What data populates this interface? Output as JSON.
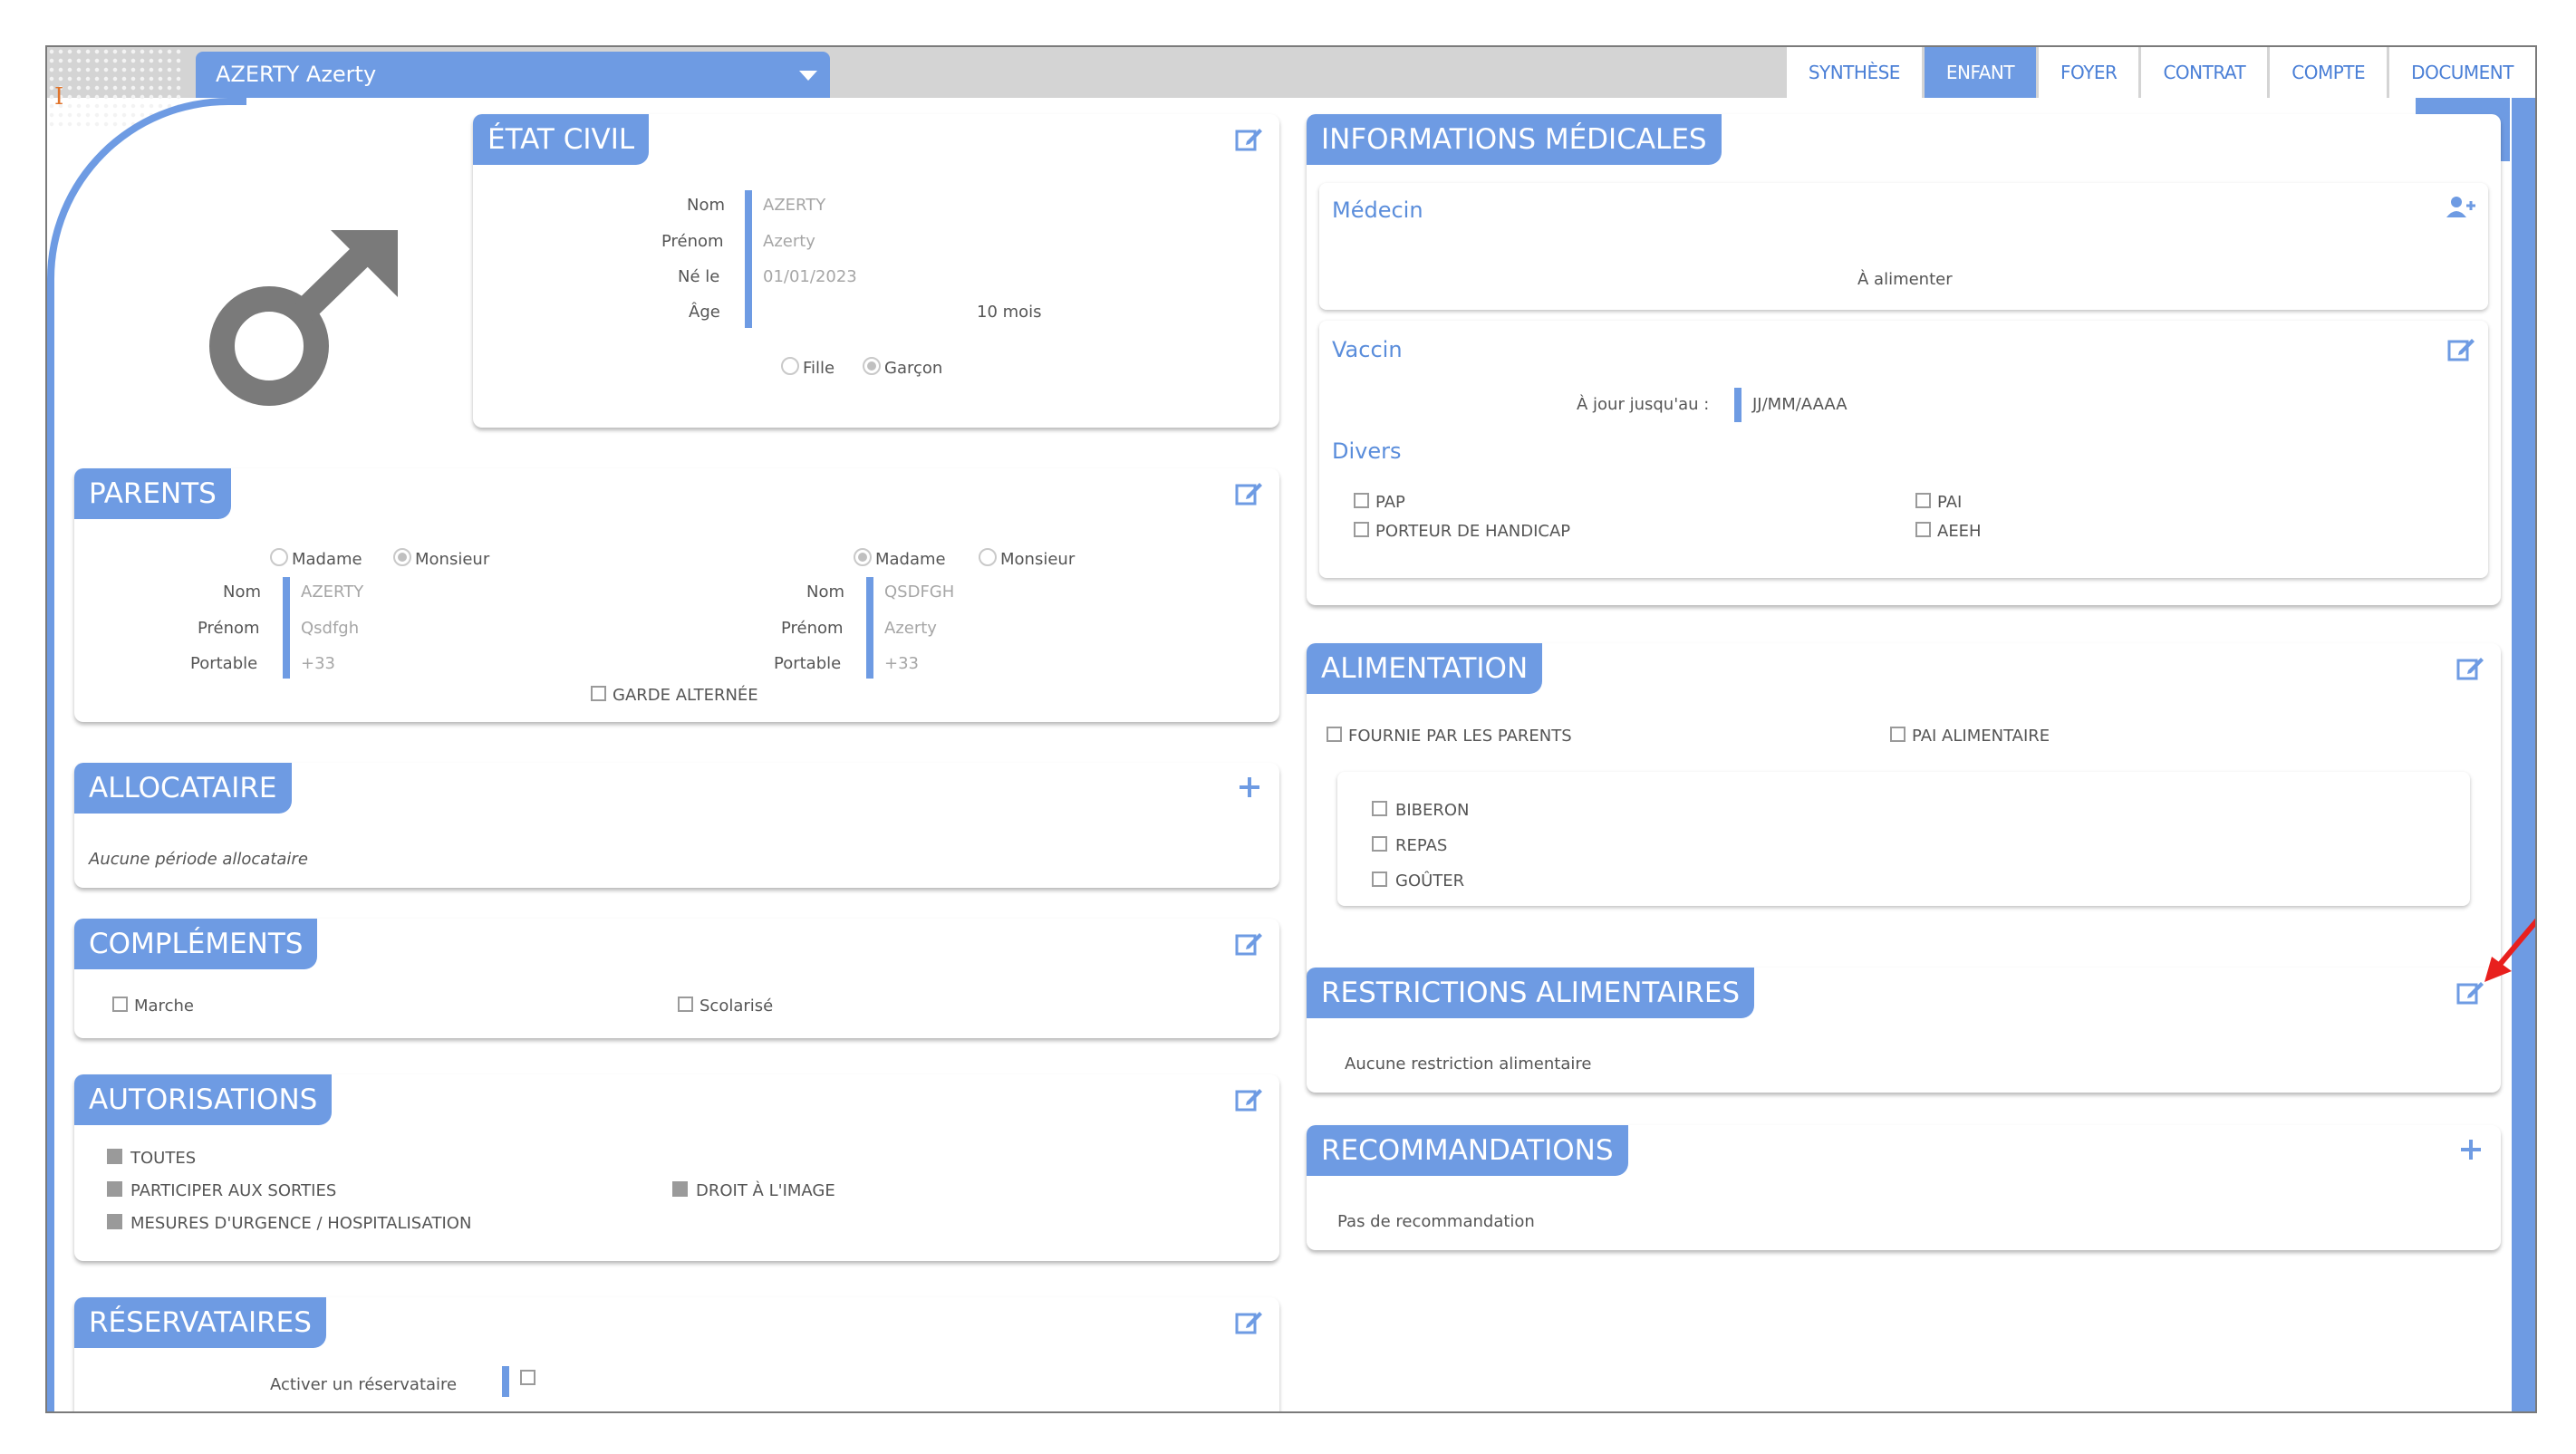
{
  "colors": {
    "accent": "#6e9be3",
    "accent_text": "#4a7fd6",
    "band": "#d4d4d4",
    "arrow": "#e8201e"
  },
  "child_selector": {
    "label": "AZERTY Azerty"
  },
  "tabs": [
    "SYNTHÈSE",
    "ENFANT",
    "FOYER",
    "CONTRAT",
    "COMPTE",
    "DOCUMENT"
  ],
  "active_tab": "ENFANT",
  "gender_symbol": "♂",
  "etat_civil": {
    "title": "ÉTAT CIVIL",
    "labels": [
      "Nom",
      "Prénom",
      "Né le",
      "Âge"
    ],
    "nom": "AZERTY",
    "prenom": "Azerty",
    "ne_le": "01/01/2023",
    "age": "10 mois",
    "gender_options": [
      "Fille",
      "Garçon"
    ],
    "gender_selected": "Garçon"
  },
  "parents": {
    "title": "PARENTS",
    "civility_options": [
      "Madame",
      "Monsieur"
    ],
    "labels": [
      "Nom",
      "Prénom",
      "Portable"
    ],
    "parent1": {
      "civility": "Monsieur",
      "nom": "AZERTY",
      "prenom": "Qsdfgh",
      "portable": "+33"
    },
    "parent2": {
      "civility": "Madame",
      "nom": "QSDFGH",
      "prenom": "Azerty",
      "portable": "+33"
    },
    "garde_alternee": "GARDE ALTERNÉE"
  },
  "allocataire": {
    "title": "ALLOCATAIRE",
    "empty": "Aucune période allocataire"
  },
  "complements": {
    "title": "COMPLÉMENTS",
    "items": [
      "Marche",
      "Scolarisé"
    ]
  },
  "autorisations": {
    "title": "AUTORISATIONS",
    "items": [
      "TOUTES",
      "PARTICIPER AUX SORTIES",
      "MESURES D'URGENCE / HOSPITALISATION",
      "DROIT À L'IMAGE"
    ]
  },
  "reservataires": {
    "title": "RÉSERVATAIRES",
    "label": "Activer un réservataire"
  },
  "medical": {
    "title": "INFORMATIONS MÉDICALES",
    "medecin": {
      "title": "Médecin",
      "empty": "À alimenter"
    },
    "vaccin": {
      "title": "Vaccin",
      "label": "À jour jusqu'au :",
      "placeholder": "JJ/MM/AAAA"
    },
    "divers": {
      "title": "Divers",
      "items": [
        "PAP",
        "PORTEUR DE HANDICAP",
        "PAI",
        "AEEH"
      ]
    }
  },
  "alimentation": {
    "title": "ALIMENTATION",
    "options": [
      "FOURNIE PAR LES PARENTS",
      "PAI ALIMENTAIRE"
    ],
    "items": [
      "BIBERON",
      "REPAS",
      "GOÛTER"
    ]
  },
  "restrictions": {
    "title": "RESTRICTIONS ALIMENTAIRES",
    "empty": "Aucune restriction alimentaire"
  },
  "recommandations": {
    "title": "RECOMMANDATIONS",
    "empty": "Pas de recommandation"
  }
}
